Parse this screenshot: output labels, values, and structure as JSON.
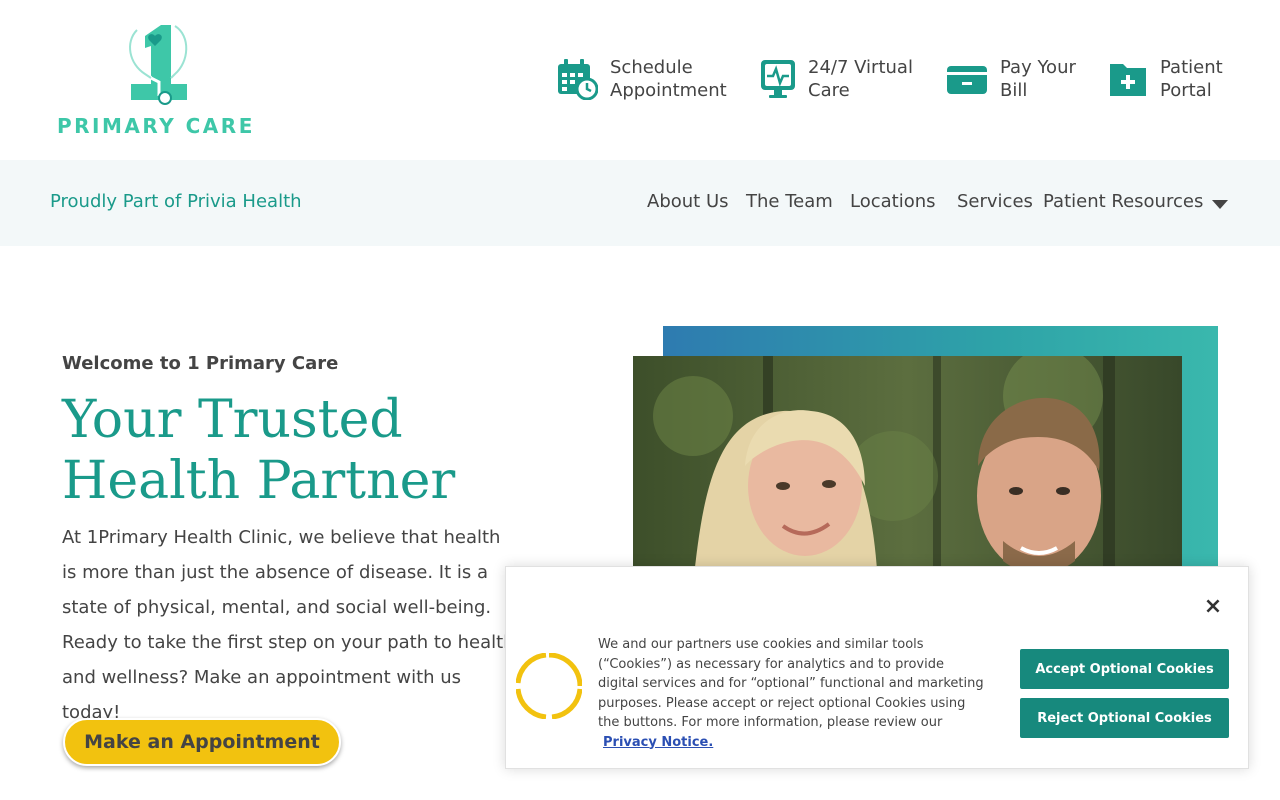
{
  "brand": {
    "logo_text": "PRIMARY CARE",
    "logo_numeral": "1",
    "color_primary": "#1a9a8a",
    "color_logo": "#3ec7a8",
    "color_cta": "#f2c20f"
  },
  "quick_links": [
    {
      "label_line1": "Schedule",
      "label_line2": "Appointment",
      "icon": "calendar-clock-icon"
    },
    {
      "label_line1": "24/7 Virtual",
      "label_line2": "Care",
      "icon": "monitor-heartbeat-icon"
    },
    {
      "label_line1": "Pay Your",
      "label_line2": "Bill",
      "icon": "credit-card-icon"
    },
    {
      "label_line1": "Patient",
      "label_line2": "Portal",
      "icon": "medical-folder-icon"
    }
  ],
  "navbar": {
    "tagline": "Proudly Part of Privia Health",
    "items": [
      "About Us",
      "The Team",
      "Locations",
      "Services",
      "Patient Resources"
    ]
  },
  "hero": {
    "eyebrow": "Welcome to 1 Primary Care",
    "title": "Your Trusted Health Partner",
    "body": "At 1Primary Health Clinic, we believe that health is more than just the absence of disease. It is a state of physical, mental, and social well-being. Ready to take the first step on your path to health and wellness? Make an appointment with us today!",
    "cta_label": "Make an Appointment"
  },
  "cookie_banner": {
    "text": "We and our partners use cookies and similar tools (“Cookies”) as necessary for analytics and to provide digital services and for “optional” functional and marketing purposes. Please accept or reject optional Cookies using the buttons. For more information, please review our",
    "link_label": "Privacy Notice.",
    "accept_label": "Accept Optional Cookies",
    "reject_label": "Reject Optional Cookies",
    "close_glyph": "×"
  }
}
